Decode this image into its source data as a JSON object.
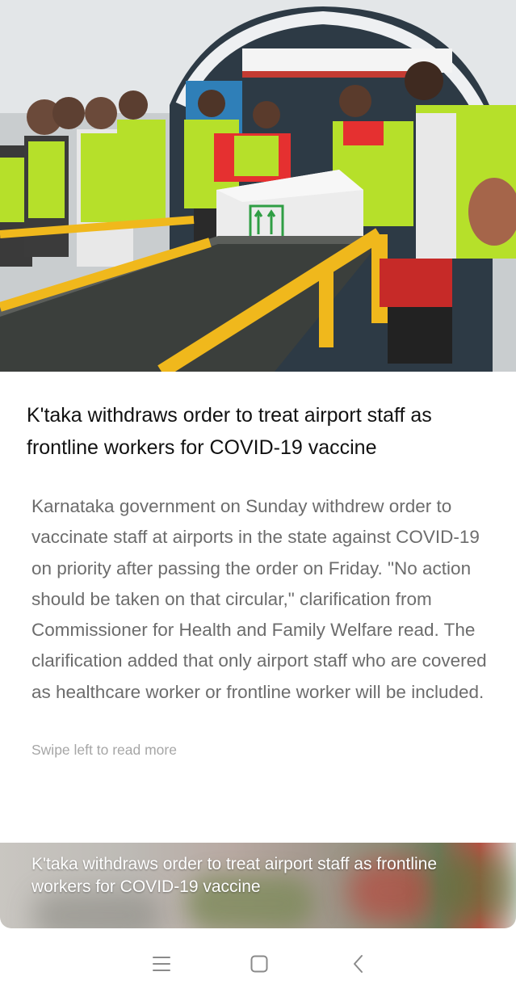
{
  "article": {
    "image_alt": "Airport staff in high-visibility vests loading a vaccine box onto a conveyor belt",
    "headline": "K'taka withdraws order to treat airport staff as frontline workers for COVID-19 vaccine",
    "summary": "Karnataka government on Sunday withdrew order to vaccinate staff at airports in the state against COVID-19 on priority after passing the order on Friday. \"No action should be taken on that circular,\" clarification from Commissioner for Health and Family Welfare read. The clarification added that only airport staff who are covered as healthcare worker or frontline worker will be included.",
    "hint": "Swipe left to read more",
    "box_label": "THIS SIDE UP"
  },
  "next_story": {
    "title": "K'taka withdraws order to treat airport staff as frontline workers for COVID-19 vaccine"
  },
  "navbar": {
    "menu_icon": "menu-icon",
    "home_icon": "home-icon",
    "back_icon": "back-icon"
  },
  "colors": {
    "headline": "#111111",
    "summary": "#6c6c6c",
    "hint": "#a6a6a6",
    "vest": "#b6e02a",
    "rail": "#f0b81c"
  }
}
